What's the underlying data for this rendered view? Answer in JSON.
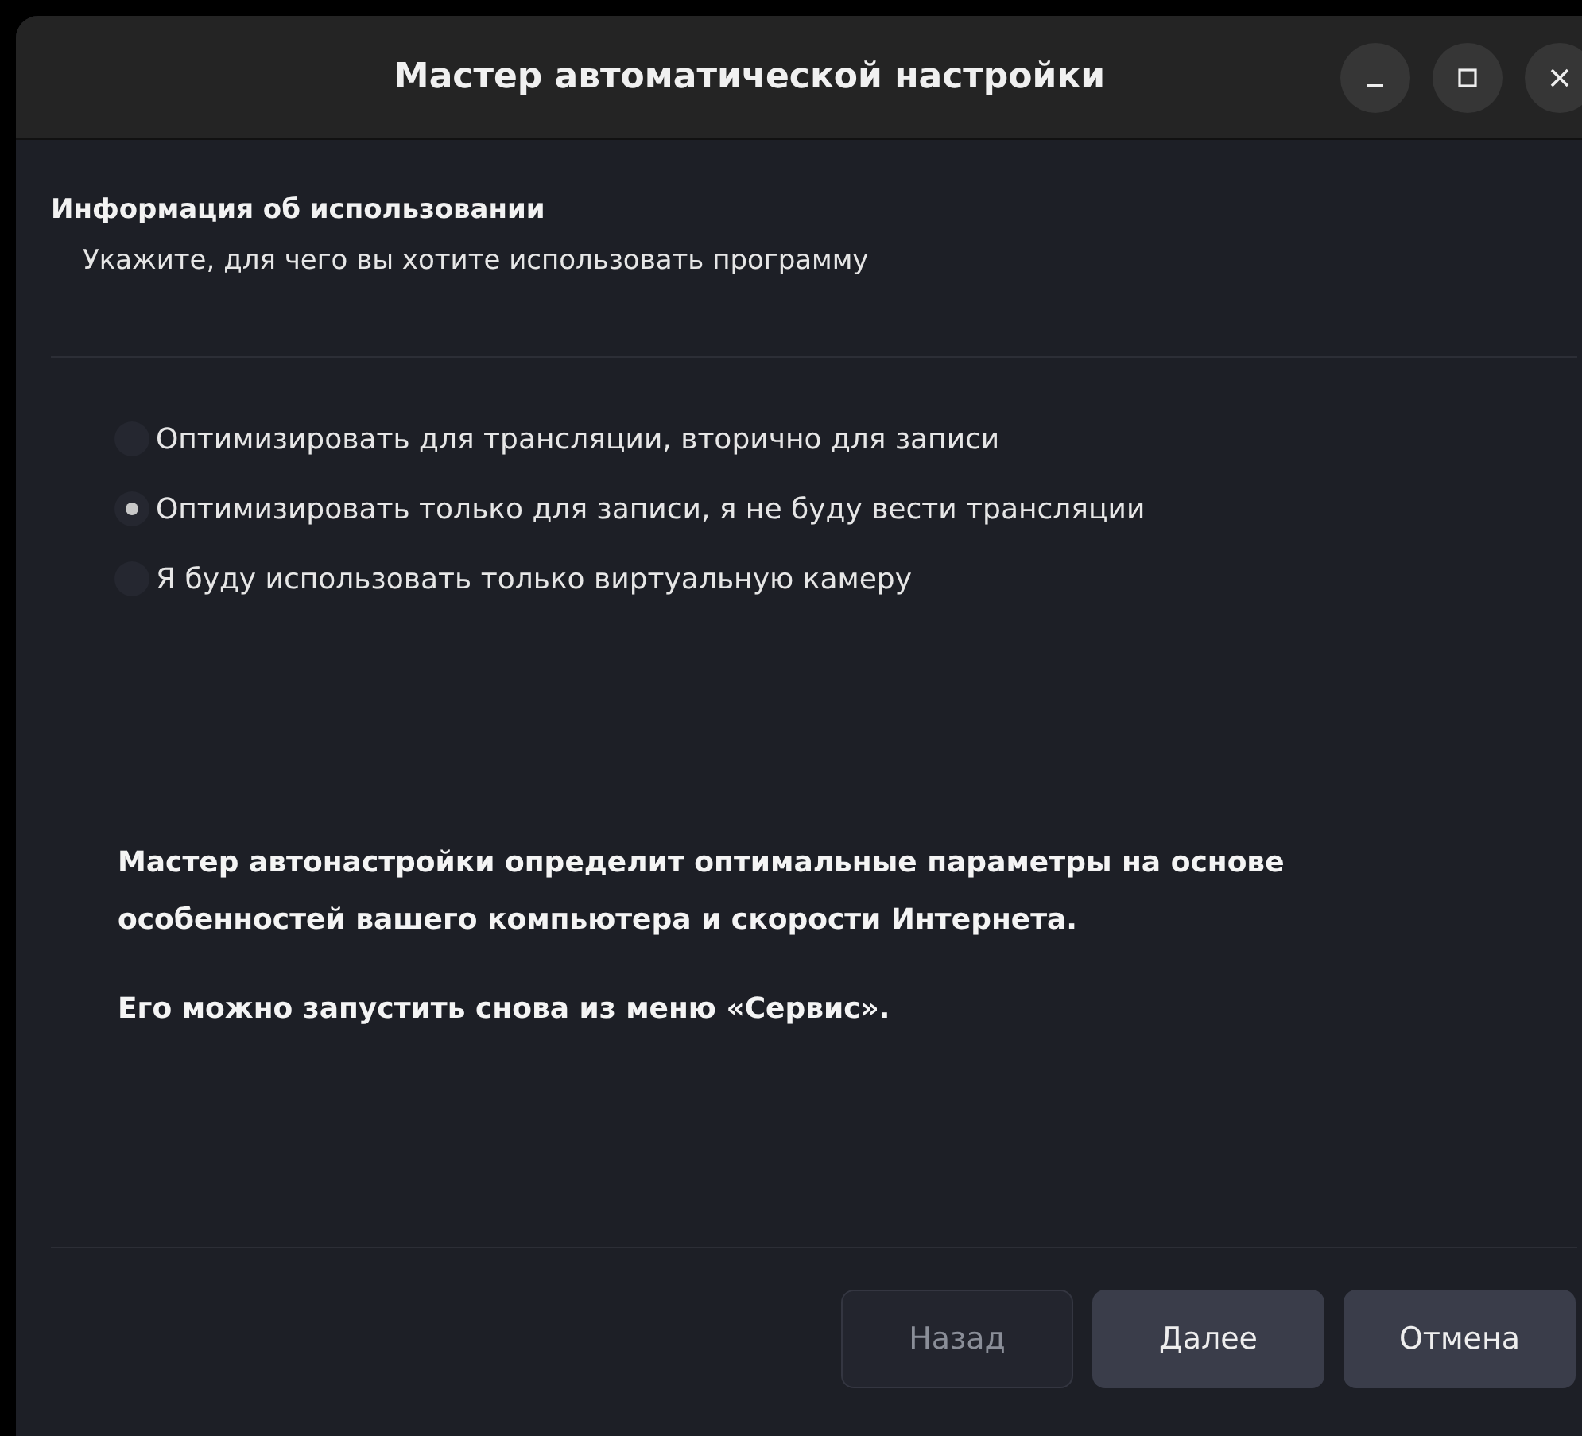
{
  "window": {
    "title": "Мастер автоматической настройки"
  },
  "heading": "Информация об использовании",
  "subheading": "Укажите, для чего вы хотите использовать программу",
  "options": [
    {
      "label": "Оптимизировать для трансляции, вторично для записи",
      "selected": false
    },
    {
      "label": "Оптимизировать только для записи, я не буду вести трансляции",
      "selected": true
    },
    {
      "label": "Я буду использовать только виртуальную камеру",
      "selected": false
    }
  ],
  "notes": [
    "Мастер автонастройки определит оптимальные параметры на основе особенностей вашего компьютера и скорости Интернета.",
    "Его можно запустить снова из меню «Сервис»."
  ],
  "buttons": [
    {
      "label": "Назад",
      "disabled": true
    },
    {
      "label": "Далее",
      "disabled": false
    },
    {
      "label": "Отмена",
      "disabled": false
    }
  ]
}
